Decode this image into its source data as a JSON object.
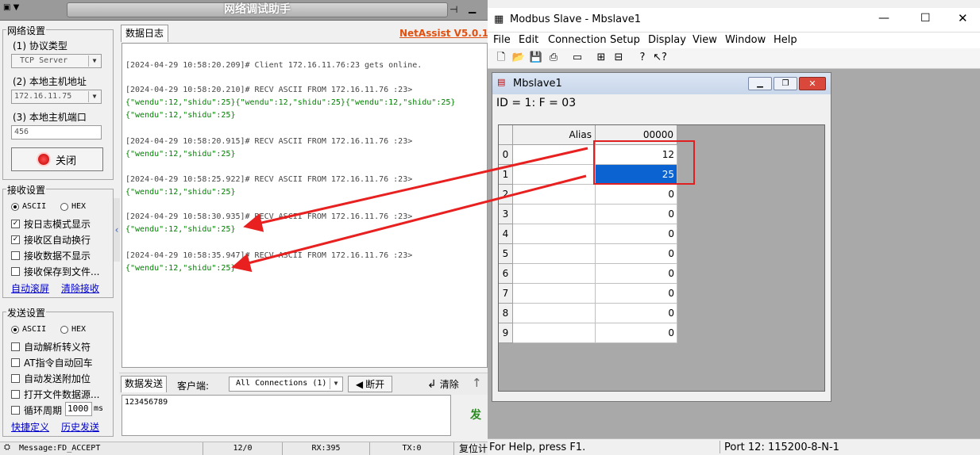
{
  "netassist": {
    "window_title": "网络调试助手",
    "brand": "NetAssist V5.0.1",
    "tab_log": "数据日志",
    "network": {
      "title": "网络设置",
      "protocol_label": "(1) 协议类型",
      "protocol_value": "TCP Server",
      "host_label": "(2) 本地主机地址",
      "host_value": "172.16.11.75",
      "port_label": "(3) 本地主机端口",
      "port_value": "456",
      "close_button": "关闭"
    },
    "receive": {
      "title": "接收设置",
      "ascii": "ASCII",
      "hex": "HEX",
      "options": [
        {
          "label": "按日志模式显示",
          "checked": true
        },
        {
          "label": "接收区自动换行",
          "checked": true
        },
        {
          "label": "接收数据不显示",
          "checked": false
        },
        {
          "label": "接收保存到文件...",
          "checked": false
        }
      ],
      "auto_scroll": "自动滚屏",
      "clear_receive": "清除接收"
    },
    "send": {
      "title": "发送设置",
      "ascii": "ASCII",
      "hex": "HEX",
      "options": [
        {
          "label": "自动解析转义符",
          "checked": false
        },
        {
          "label": "AT指令自动回车",
          "checked": false
        },
        {
          "label": "自动发送附加位",
          "checked": false
        },
        {
          "label": "打开文件数据源...",
          "checked": false
        },
        {
          "label": "循环周期",
          "checked": false
        }
      ],
      "period_value": "1000",
      "period_unit": "ms",
      "quick_def": "快捷定义",
      "history": "历史发送"
    },
    "log_lines": [
      {
        "text": "[2024-04-29 10:58:20.209]# Client 172.16.11.76:23 gets online.",
        "kind": "gray"
      },
      {
        "text": "[2024-04-29 10:58:20.210]# RECV ASCII FROM 172.16.11.76 :23>",
        "kind": "gray"
      },
      {
        "text": "{\"wendu\":12,\"shidu\":25}{\"wendu\":12,\"shidu\":25}{\"wendu\":12,\"shidu\":25}",
        "kind": "green"
      },
      {
        "text": "{\"wendu\":12,\"shidu\":25}",
        "kind": "green"
      },
      {
        "text": "[2024-04-29 10:58:20.915]# RECV ASCII FROM 172.16.11.76 :23>",
        "kind": "gray"
      },
      {
        "text": "{\"wendu\":12,\"shidu\":25}",
        "kind": "green"
      },
      {
        "text": "[2024-04-29 10:58:25.922]# RECV ASCII FROM 172.16.11.76 :23>",
        "kind": "gray"
      },
      {
        "text": "{\"wendu\":12,\"shidu\":25}",
        "kind": "green"
      },
      {
        "text": "[2024-04-29 10:58:30.935]# RECV ASCII FROM 172.16.11.76 :23>",
        "kind": "gray"
      },
      {
        "text": "{\"wendu\":12,\"shidu\":25}",
        "kind": "green"
      },
      {
        "text": "[2024-04-29 10:58:35.947]# RECV ASCII FROM 172.16.11.76 :23>",
        "kind": "gray"
      },
      {
        "text": "{\"wendu\":12,\"shidu\":25}",
        "kind": "green"
      }
    ],
    "sendbar": {
      "tab": "数据发送",
      "client_label": "客户端:",
      "client_value": "All Connections (1)",
      "disconnect": "断开",
      "clear": "清除",
      "send_text": "123456789",
      "send_button": "发送"
    },
    "status": {
      "message": "Message:FD_ACCEPT",
      "count": "12/0",
      "rx": "RX:395",
      "tx": "TX:0",
      "reset": "复位计数"
    }
  },
  "modbus": {
    "window_title": "Modbus Slave - Mbslave1",
    "menu": [
      "File",
      "Edit",
      "Connection",
      "Setup",
      "Display",
      "View",
      "Window",
      "Help"
    ],
    "child_title": "Mbslave1",
    "id_line": "ID = 1: F = 03",
    "col_alias": "Alias",
    "col_addr": "00000",
    "rows": [
      {
        "idx": "0",
        "value": "12"
      },
      {
        "idx": "1",
        "value": "25"
      },
      {
        "idx": "2",
        "value": "0"
      },
      {
        "idx": "3",
        "value": "0"
      },
      {
        "idx": "4",
        "value": "0"
      },
      {
        "idx": "5",
        "value": "0"
      },
      {
        "idx": "6",
        "value": "0"
      },
      {
        "idx": "7",
        "value": "0"
      },
      {
        "idx": "8",
        "value": "0"
      },
      {
        "idx": "9",
        "value": "0"
      }
    ],
    "status_help": "For Help, press F1.",
    "status_port": "Port 12: 115200-8-N-1"
  }
}
